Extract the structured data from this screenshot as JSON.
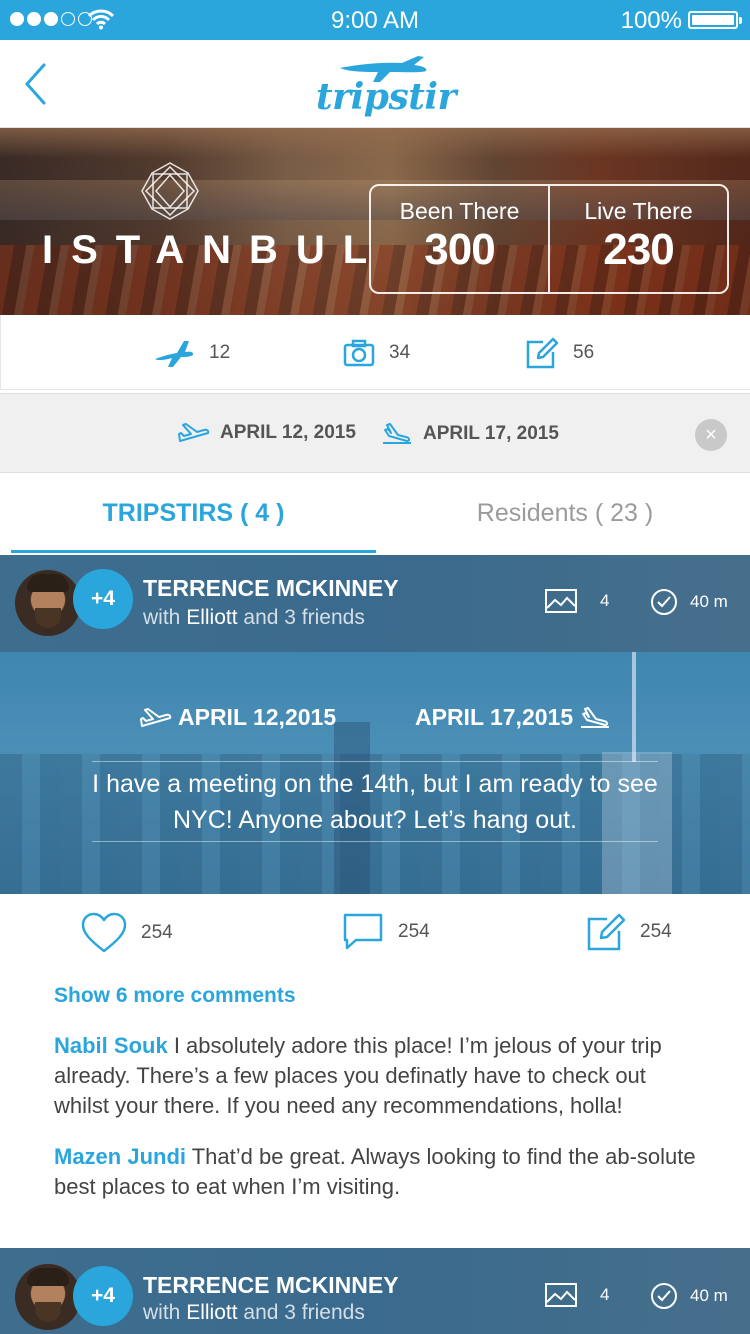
{
  "status_bar": {
    "time": "9:00 AM",
    "battery": "100%",
    "signal_strength": 3,
    "signal_max": 5
  },
  "nav": {
    "logo_text": "tripstir",
    "brand_color": "#2aa6dd"
  },
  "hero": {
    "city": "ISTANBUL",
    "been_there_label": "Been There",
    "been_there_value": "300",
    "live_there_label": "Live There",
    "live_there_value": "230"
  },
  "counts": {
    "trips": "12",
    "photos": "34",
    "posts": "56"
  },
  "date_filter": {
    "departure": "APRIL 12, 2015",
    "return": "APRIL 17, 2015",
    "clear_icon": "×"
  },
  "tabs": {
    "tripstirs": "TRIPSTIRS ( 4 )",
    "residents": "Residents ( 23 )"
  },
  "posts": [
    {
      "extra_count": "+4",
      "name": "TERRENCE MCKINNEY",
      "with_prefix": "with",
      "with_friend": "Elliott",
      "with_suffix": "and 3 friends",
      "photo_count": "4",
      "time_ago": "40 m",
      "departure": "APRIL 12,2015",
      "return": "APRIL 17,2015",
      "text": "I have a meeting on the 14th, but I am ready to see NYC! Anyone about? Let’s hang out.",
      "likes": "254",
      "comments": "254",
      "edits": "254",
      "show_more": "Show 6 more comments",
      "comment_list": [
        {
          "author": "Nabil Souk",
          "text": "I absolutely adore this place! I’m jelous of your trip already. There’s a few places you definatly have to check out whilst your there. If you need any recommendations, holla!"
        },
        {
          "author": "Mazen Jundi",
          "text": "That’d be great. Always looking to find the ab-solute best places to eat when I’m visiting."
        }
      ]
    },
    {
      "extra_count": "+4",
      "name": "TERRENCE MCKINNEY",
      "with_prefix": "with",
      "with_friend": "Elliott",
      "with_suffix": "and 3 friends",
      "photo_count": "4",
      "time_ago": "40 m"
    }
  ]
}
